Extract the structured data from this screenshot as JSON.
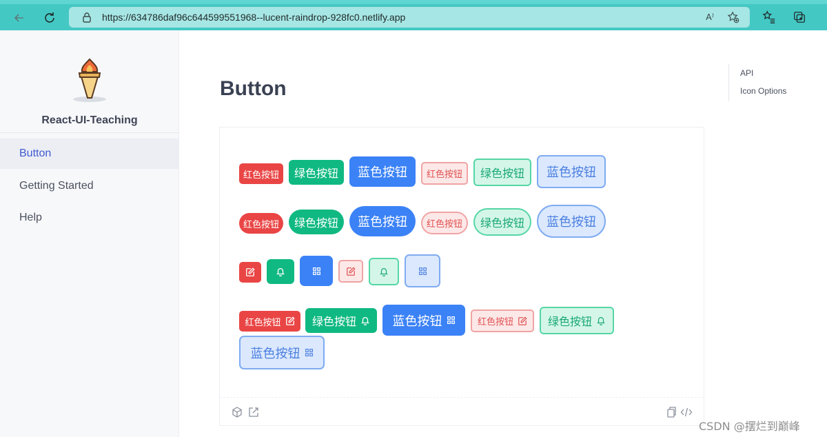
{
  "browser": {
    "url": "https://634786daf96c644599551968--lucent-raindrop-928fc0.netlify.app",
    "read_aloud_label": "A⁾",
    "colors": {
      "chrome": "#44c8c4",
      "address_bar": "#a6e6e4"
    }
  },
  "sidebar": {
    "brand": "React-UI-Teaching",
    "items": [
      {
        "label": "Button",
        "active": true
      },
      {
        "label": "Getting Started",
        "active": false
      },
      {
        "label": "Help",
        "active": false
      }
    ]
  },
  "main": {
    "title": "Button",
    "toc": [
      "API",
      "Icon Options"
    ]
  },
  "demo": {
    "labels": {
      "red": "红色按钮",
      "green": "绿色按钮",
      "blue": "蓝色按钮"
    },
    "rows": [
      {
        "shape": "rounded",
        "content": "text"
      },
      {
        "shape": "pill",
        "content": "text"
      },
      {
        "shape": "rounded",
        "content": "icon"
      },
      {
        "shape": "rounded",
        "content": "text+icon"
      }
    ],
    "icons": {
      "red": "edit-icon",
      "green": "bell-icon",
      "blue": "grid-icon"
    },
    "colors": {
      "red": "#ea4545",
      "green": "#10b981",
      "blue": "#3b82f6"
    }
  },
  "watermark": "CSDN @摆烂到巅峰"
}
